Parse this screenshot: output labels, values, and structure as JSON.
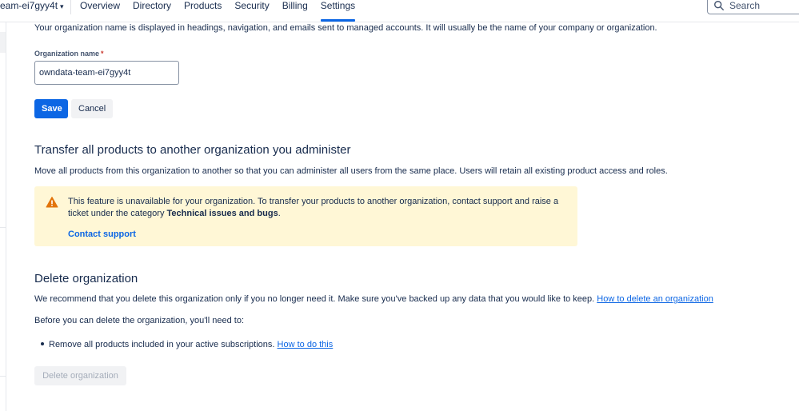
{
  "nav": {
    "org_name": "eam-ei7gyy4t",
    "tabs": [
      {
        "label": "Overview"
      },
      {
        "label": "Directory"
      },
      {
        "label": "Products"
      },
      {
        "label": "Security"
      },
      {
        "label": "Billing"
      },
      {
        "label": "Settings"
      }
    ],
    "active_tab": "Settings",
    "search_placeholder": "Search"
  },
  "org_name_section": {
    "description": "Your organization name is displayed in headings, navigation, and emails sent to managed accounts. It will usually be the name of your company or organization.",
    "field_label": "Organization name",
    "required_marker": "*",
    "field_value": "owndata-team-ei7gyy4t",
    "save_label": "Save",
    "cancel_label": "Cancel"
  },
  "transfer_section": {
    "heading": "Transfer all products to another organization you administer",
    "description": "Move all products from this organization to another so that you can administer all users from the same place. Users will retain all existing product access and roles.",
    "warning": {
      "text_before": "This feature is unavailable for your organization. To transfer your products to another organization, contact support and raise a ticket under the category ",
      "category": "Technical issues and bugs",
      "text_after": ".",
      "link_label": "Contact support"
    }
  },
  "delete_section": {
    "heading": "Delete organization",
    "description": "We recommend that you delete this organization only if you no longer need it. Make sure you've backed up any data that you would like to keep.",
    "description_link": "How to delete an organization",
    "prereq_intro": "Before you can delete the organization, you'll need to:",
    "prereq_item": "Remove all products included in your active subscriptions.",
    "prereq_link": "How to do this",
    "delete_button": "Delete organization"
  },
  "colors": {
    "primary": "#0c66e4",
    "warning_bg": "#fff7d6",
    "warning_icon": "#e2740b",
    "text": "#172b4d"
  }
}
